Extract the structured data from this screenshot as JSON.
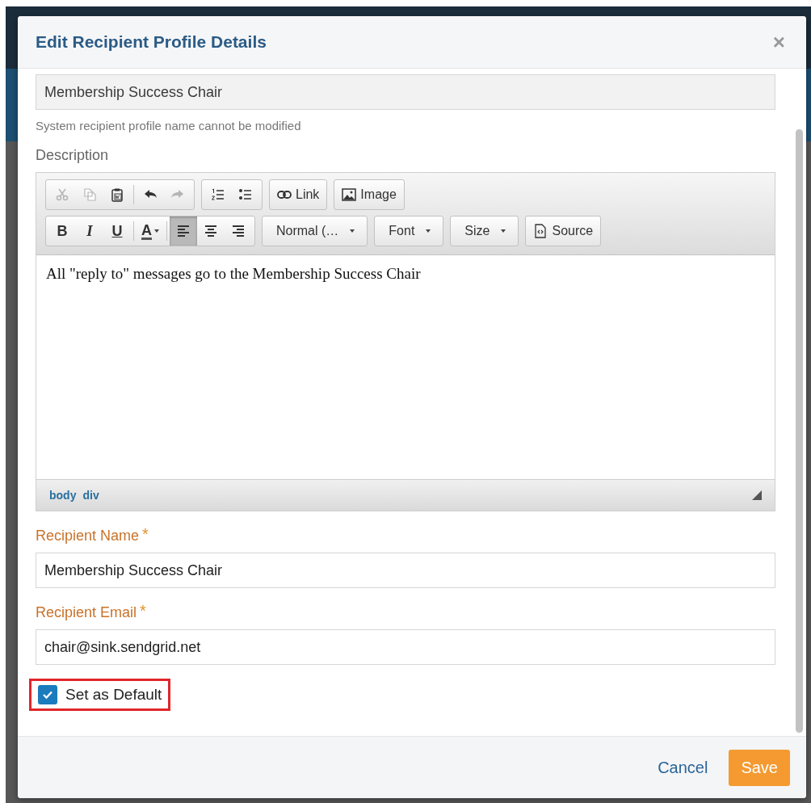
{
  "dialog": {
    "title": "Edit Recipient Profile Details",
    "close": "×"
  },
  "profile_name": {
    "value": "Membership Success Chair",
    "disabled": true
  },
  "profile_name_hint": "System recipient profile name cannot be modified",
  "description": {
    "label": "Description",
    "toolbar": [
      [
        [
          {
            "kind": "icon",
            "disabled": true
          },
          {
            "kind": "icon",
            "disabled": true
          },
          {
            "kind": "icon",
            "disabled": false
          },
          {
            "kind": "separator"
          },
          {
            "kind": "icon",
            "disabled": false
          },
          {
            "kind": "icon",
            "disabled": true
          }
        ],
        [
          {
            "kind": "icon",
            "disabled": false
          },
          {
            "kind": "icon",
            "disabled": false
          }
        ],
        [
          {
            "kind": "labeled",
            "label": "Link"
          }
        ],
        [
          {
            "kind": "labeled",
            "label": "Image"
          }
        ]
      ],
      [
        [
          {
            "kind": "bold",
            "label": "B"
          },
          {
            "kind": "italic",
            "label": "I"
          },
          {
            "kind": "underline",
            "label": "U"
          },
          {
            "kind": "separator"
          },
          {
            "kind": "color",
            "label": "A"
          },
          {
            "kind": "separator"
          },
          {
            "kind": "icon",
            "selected": true
          },
          {
            "kind": "icon",
            "selected": false
          },
          {
            "kind": "icon",
            "selected": false
          }
        ],
        [
          {
            "kind": "dropdown",
            "label": "Normal (…"
          }
        ],
        [
          {
            "kind": "dropdown",
            "label": "Font"
          }
        ],
        [
          {
            "kind": "dropdown",
            "label": "Size"
          }
        ],
        [
          {
            "kind": "labeled",
            "label": "Source"
          }
        ]
      ]
    ],
    "content": "All \"reply to\" messages go to the Membership Success Chair",
    "path": [
      "body",
      "div"
    ]
  },
  "recipient_name": {
    "label": "Recipient Name",
    "required_mark": "*",
    "value": "Membership Success Chair"
  },
  "recipient_email": {
    "label": "Recipient Email",
    "required_mark": "*",
    "value": "chair@sink.sendgrid.net"
  },
  "set_default": {
    "label": "Set as Default",
    "checked": true,
    "highlighted": true
  },
  "footer": {
    "cancel": "Cancel",
    "save": "Save"
  }
}
